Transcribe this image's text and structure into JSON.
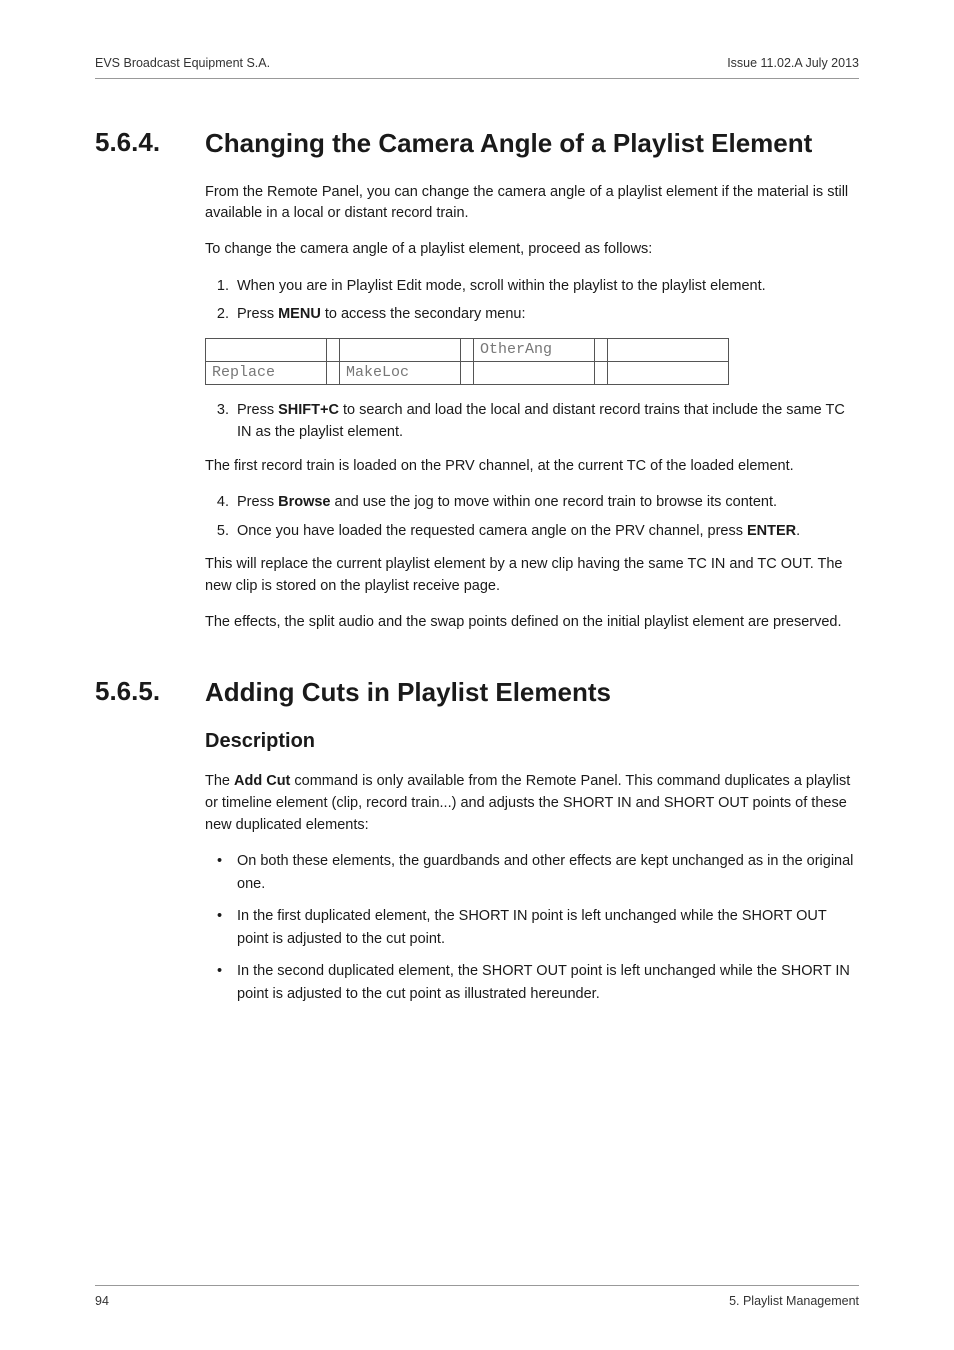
{
  "header": {
    "left": "EVS Broadcast Equipment S.A.",
    "right": "Issue 11.02.A  July 2013"
  },
  "s1": {
    "num": "5.6.4.",
    "title": "Changing the Camera Angle of a Playlist Element",
    "p1": "From the Remote Panel, you can change the camera angle of a playlist element if the material is still available in a local or distant record train.",
    "p2": "To change the camera angle of a playlist element, proceed as follows:",
    "li1": "When you are in Playlist Edit mode, scroll within the playlist to the playlist element.",
    "li2a": "Press ",
    "li2b": "MENU",
    "li2c": " to access the secondary menu:",
    "li3a": "Press ",
    "li3b": "SHIFT+C",
    "li3c": " to search and load the local and distant record trains that include the same TC IN as the playlist element.",
    "p3": "The first record train is loaded on the PRV channel, at the current TC of the loaded element.",
    "li4a": "Press ",
    "li4b": "Browse",
    "li4c": " and use the jog to move within one record train to browse its content.",
    "li5a": "Once you have loaded the requested camera angle on the PRV channel, press ",
    "li5b": "ENTER",
    "li5c": ".",
    "p4": "This will replace the current playlist element by a new clip having the same TC IN and TC OUT. The new clip is stored on the playlist receive page.",
    "p5": "The effects, the split audio and the swap points defined on the initial playlist element are preserved."
  },
  "menu": {
    "r1c1": "",
    "r1c2": "",
    "r1c3": "OtherAng",
    "r1c4": "",
    "r2c1": "Replace",
    "r2c2": "MakeLoc",
    "r2c3": "",
    "r2c4": ""
  },
  "s2": {
    "num": "5.6.5.",
    "title": "Adding Cuts in Playlist Elements",
    "sub": "Description",
    "p1a": "The ",
    "p1b": "Add Cut",
    "p1c": " command is only available from the Remote Panel. This command duplicates a playlist or timeline element (clip, record train...) and adjusts the SHORT IN and SHORT OUT points of these new duplicated elements:",
    "b1": "On both these elements, the guardbands and other effects are kept unchanged as in the original one.",
    "b2": "In the first duplicated element, the SHORT IN point is left unchanged while the SHORT OUT point is adjusted to the cut point.",
    "b3": "In the second duplicated element, the SHORT OUT point is left unchanged while the SHORT IN point is adjusted to the cut point as illustrated hereunder."
  },
  "footer": {
    "left": "94",
    "right": "5. Playlist Management"
  }
}
